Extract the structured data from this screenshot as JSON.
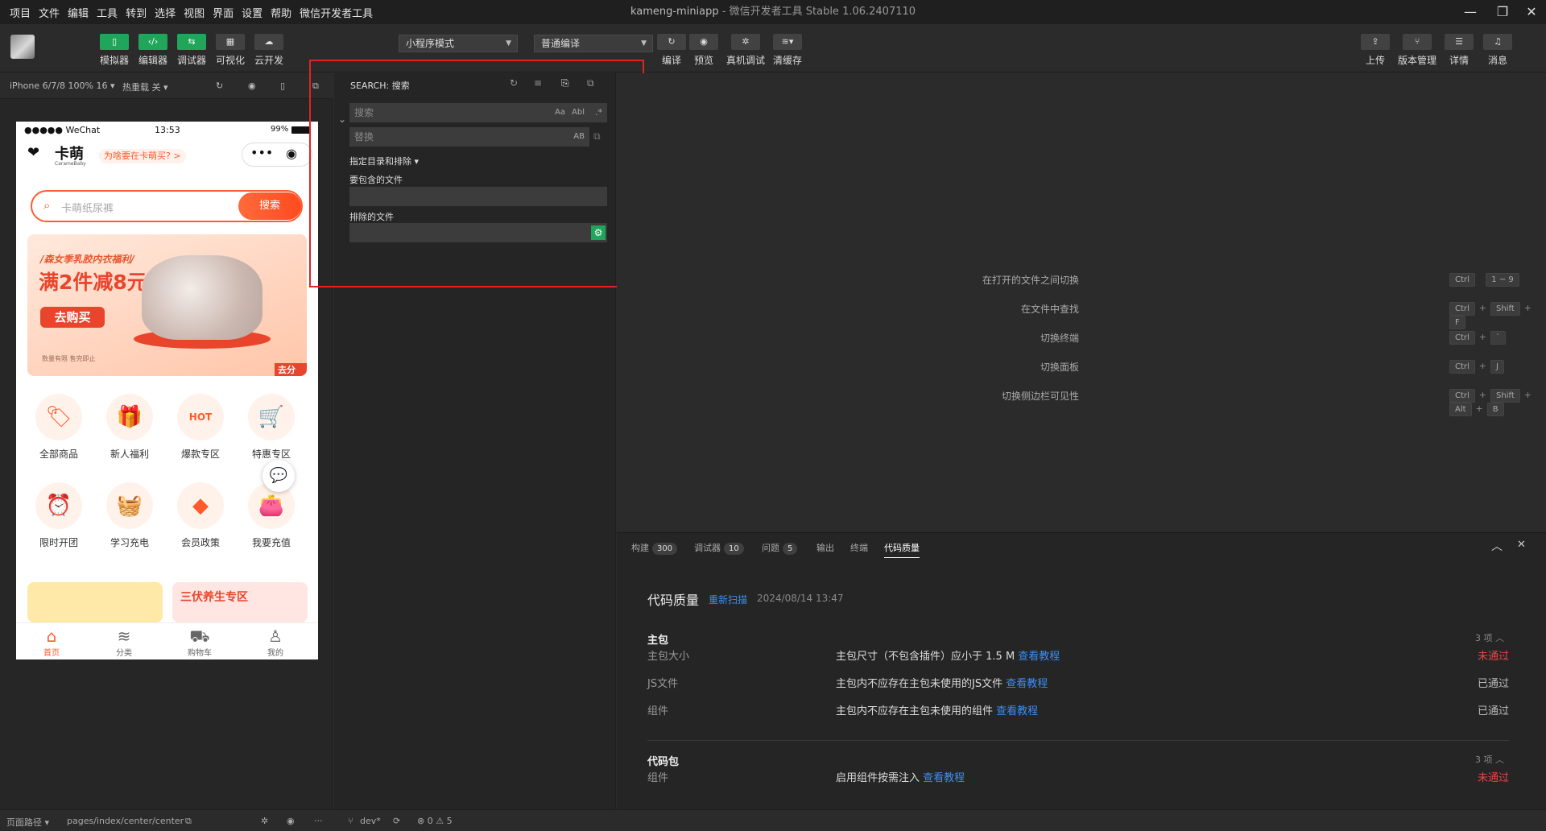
{
  "menubar": {
    "items": [
      "项目",
      "文件",
      "编辑",
      "工具",
      "转到",
      "选择",
      "视图",
      "界面",
      "设置",
      "帮助",
      "微信开发者工具"
    ]
  },
  "window": {
    "project": "kameng-miniapp",
    "separator": " - ",
    "app": "微信开发者工具 Stable 1.06.2407110"
  },
  "toolbar": {
    "simulator": "模拟器",
    "editor": "编辑器",
    "debugger": "调试器",
    "visual": "可视化",
    "cloud": "云开发",
    "mode_select": "小程序模式",
    "compile_select": "普通编译",
    "compile": "编译",
    "preview": "预览",
    "real_debug": "真机调试",
    "clear_cache": "清缓存",
    "upload": "上传",
    "version": "版本管理",
    "details": "详情",
    "messages": "消息"
  },
  "simbar": {
    "device": "iPhone 6/7/8 100% 16 ▾",
    "hotreload": "热重载 关 ▾"
  },
  "phone": {
    "carrier": "●●●●● WeChat",
    "time": "13:53",
    "battery": "99%",
    "brand": "卡萌",
    "brand_sub": "CarameBaby",
    "why_link": "为啥要在卡萌买? >",
    "search_placeholder": "卡萌纸尿裤",
    "search_btn": "搜索",
    "banner": {
      "tag": "/森女季乳胶内衣福利/",
      "headline": "满2件减8元",
      "cta": "去购买",
      "note": "数量有限 售完即止",
      "share": "去分享"
    },
    "categories": [
      "全部商品",
      "新人福利",
      "爆款专区",
      "特惠专区",
      "限时开团",
      "学习充电",
      "会员政策",
      "我要充值"
    ],
    "promo_right": "三伏养生专区",
    "tabs": [
      "首页",
      "分类",
      "购物车",
      "我的"
    ]
  },
  "searchpanel": {
    "title": "SEARCH: 搜索",
    "search_placeholder": "搜索",
    "replace_placeholder": "替换",
    "opt_case": "Aa",
    "opt_word": "Abl",
    "opt_regex": ".*",
    "opt_preserve": "AB",
    "toggle_dirs": "指定目录和排除 ▾",
    "include_label": "要包含的文件",
    "exclude_label": "排除的文件"
  },
  "shortcuts": [
    {
      "label": "在打开的文件之间切换",
      "keys": [
        "Ctrl",
        "1 ~ 9"
      ],
      "sep": [
        " "
      ]
    },
    {
      "label": "在文件中查找",
      "keys": [
        "Ctrl",
        "Shift",
        "F"
      ],
      "sep": [
        "+",
        "+"
      ]
    },
    {
      "label": "切换终端",
      "keys": [
        "Ctrl",
        "`"
      ],
      "sep": [
        "+"
      ]
    },
    {
      "label": "切换面板",
      "keys": [
        "Ctrl",
        "J"
      ],
      "sep": [
        "+"
      ]
    },
    {
      "label": "切换侧边栏可见性",
      "keys": [
        "Ctrl",
        "Shift",
        "Alt",
        "B"
      ],
      "sep": [
        "+",
        "+",
        "+"
      ]
    }
  ],
  "panel": {
    "tabs": [
      {
        "label": "构建",
        "badge": "300"
      },
      {
        "label": "调试器",
        "badge": "10"
      },
      {
        "label": "问题",
        "badge": "5"
      },
      {
        "label": "输出",
        "badge": ""
      },
      {
        "label": "终端",
        "badge": ""
      },
      {
        "label": "代码质量",
        "badge": ""
      }
    ],
    "title": "代码质量",
    "rescan": "重新扫描",
    "timestamp": "2024/08/14 13:47",
    "section_main": "主包",
    "section_main_count": "3 项 ︿",
    "rows_main": [
      {
        "name": "主包大小",
        "desc": "主包尺寸（不包含插件）应小于 1.5 M",
        "link": "查看教程",
        "status": "未通过",
        "fail": true
      },
      {
        "name": "JS文件",
        "desc": "主包内不应存在主包未使用的JS文件",
        "link": "查看教程",
        "status": "已通过",
        "fail": false
      },
      {
        "name": "组件",
        "desc": "主包内不应存在主包未使用的组件",
        "link": "查看教程",
        "status": "已通过",
        "fail": false
      }
    ],
    "section_code": "代码包",
    "section_code_count": "3 项 ︿",
    "rows_code": [
      {
        "name": "组件",
        "desc": "启用组件按需注入",
        "link": "查看教程",
        "status": "未通过",
        "fail": true
      }
    ]
  },
  "statusbar": {
    "path_label": "页面路径 ▾",
    "path": "pages/index/center/center",
    "branch": "dev*",
    "problems": "⊗ 0 ⚠ 5"
  },
  "colors": {
    "accent_green": "#21a55a",
    "brand_orange": "#ff5a2a",
    "link": "#3c8ef3",
    "fail": "#f04343",
    "highlight_box": "#e02424"
  }
}
